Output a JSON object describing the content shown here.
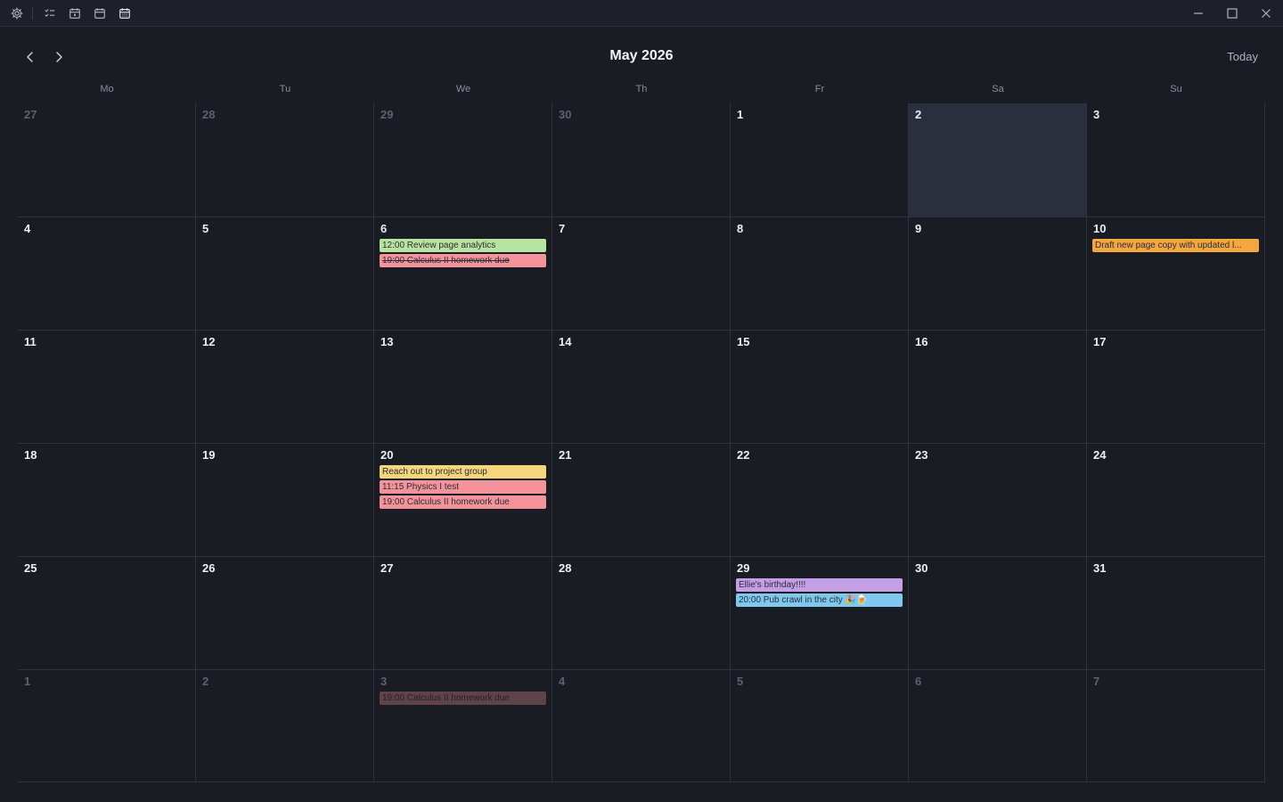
{
  "toolbar": {
    "icons": [
      "gear-icon",
      "task-list-icon",
      "calendar-day-icon",
      "calendar-week-icon",
      "calendar-month-icon"
    ]
  },
  "window_controls": [
    "minimize-icon",
    "maximize-icon",
    "close-icon"
  ],
  "header": {
    "title": "May 2026",
    "today_label": "Today"
  },
  "weekdays": [
    "Mo",
    "Tu",
    "We",
    "Th",
    "Fr",
    "Sa",
    "Su"
  ],
  "selected_day": "2",
  "days": [
    {
      "num": "27",
      "muted": true,
      "events": []
    },
    {
      "num": "28",
      "muted": true,
      "events": []
    },
    {
      "num": "29",
      "muted": true,
      "events": []
    },
    {
      "num": "30",
      "muted": true,
      "events": []
    },
    {
      "num": "1",
      "muted": false,
      "events": []
    },
    {
      "num": "2",
      "muted": false,
      "selected": true,
      "events": []
    },
    {
      "num": "3",
      "muted": false,
      "events": []
    },
    {
      "num": "4",
      "muted": false,
      "events": []
    },
    {
      "num": "5",
      "muted": false,
      "events": []
    },
    {
      "num": "6",
      "muted": false,
      "events": [
        {
          "label": "12:00 Review page analytics",
          "color": "#b9e3a0",
          "done": false
        },
        {
          "label": "19:00 Calculus II homework due",
          "color": "#f4939a",
          "done": true
        }
      ]
    },
    {
      "num": "7",
      "muted": false,
      "events": []
    },
    {
      "num": "8",
      "muted": false,
      "events": []
    },
    {
      "num": "9",
      "muted": false,
      "events": []
    },
    {
      "num": "10",
      "muted": false,
      "events": [
        {
          "label": " Draft new page copy with updated l...",
          "color": "#f4a73e",
          "done": false
        }
      ]
    },
    {
      "num": "11",
      "muted": false,
      "events": []
    },
    {
      "num": "12",
      "muted": false,
      "events": []
    },
    {
      "num": "13",
      "muted": false,
      "events": []
    },
    {
      "num": "14",
      "muted": false,
      "events": []
    },
    {
      "num": "15",
      "muted": false,
      "events": []
    },
    {
      "num": "16",
      "muted": false,
      "events": []
    },
    {
      "num": "17",
      "muted": false,
      "events": []
    },
    {
      "num": "18",
      "muted": false,
      "events": []
    },
    {
      "num": "19",
      "muted": false,
      "events": []
    },
    {
      "num": "20",
      "muted": false,
      "events": [
        {
          "label": " Reach out to project group",
          "color": "#f6d67a",
          "done": false
        },
        {
          "label": "11:15 Physics I test",
          "color": "#f4939a",
          "done": false
        },
        {
          "label": "19:00 Calculus II homework due",
          "color": "#f4939a",
          "done": false
        }
      ]
    },
    {
      "num": "21",
      "muted": false,
      "events": []
    },
    {
      "num": "22",
      "muted": false,
      "events": []
    },
    {
      "num": "23",
      "muted": false,
      "events": []
    },
    {
      "num": "24",
      "muted": false,
      "events": []
    },
    {
      "num": "25",
      "muted": false,
      "events": []
    },
    {
      "num": "26",
      "muted": false,
      "events": []
    },
    {
      "num": "27",
      "muted": false,
      "events": []
    },
    {
      "num": "28",
      "muted": false,
      "events": []
    },
    {
      "num": "29",
      "muted": false,
      "events": [
        {
          "label": " Ellie's birthday!!!!",
          "color": "#c59ee6",
          "done": false
        },
        {
          "label": "20:00 Pub crawl in the city 🎉🍺",
          "color": "#7fc9ee",
          "done": false
        }
      ]
    },
    {
      "num": "30",
      "muted": false,
      "events": []
    },
    {
      "num": "31",
      "muted": false,
      "events": []
    },
    {
      "num": "1",
      "muted": true,
      "events": []
    },
    {
      "num": "2",
      "muted": true,
      "events": []
    },
    {
      "num": "3",
      "muted": true,
      "events": [
        {
          "label": "19:00 Calculus II homework due",
          "color": "#f4939a",
          "done": false
        }
      ]
    },
    {
      "num": "4",
      "muted": true,
      "events": []
    },
    {
      "num": "5",
      "muted": true,
      "events": []
    },
    {
      "num": "6",
      "muted": true,
      "events": []
    },
    {
      "num": "7",
      "muted": true,
      "events": []
    }
  ]
}
